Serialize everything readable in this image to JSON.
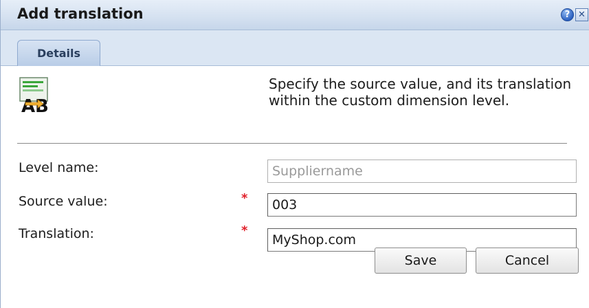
{
  "dialog": {
    "title": "Add translation",
    "help_glyph": "?",
    "close_glyph": "✕"
  },
  "tabs": [
    {
      "label": "Details",
      "active": true
    }
  ],
  "intro": {
    "icon": "ab-translation-icon",
    "text": "Specify the source value, and its translation within the custom dimension level."
  },
  "form": {
    "level_name": {
      "label": "Level name:",
      "value": "Suppliername",
      "readonly": true
    },
    "source_value": {
      "label": "Source value:",
      "required_mark": "*",
      "value": "003"
    },
    "translation": {
      "label": "Translation:",
      "required_mark": "*",
      "value": "MyShop.com"
    }
  },
  "buttons": {
    "save": "Save",
    "cancel": "Cancel"
  },
  "colors": {
    "titlebar": "#d6e2f1",
    "required": "#e0202a",
    "tab": "#b9cde7"
  }
}
